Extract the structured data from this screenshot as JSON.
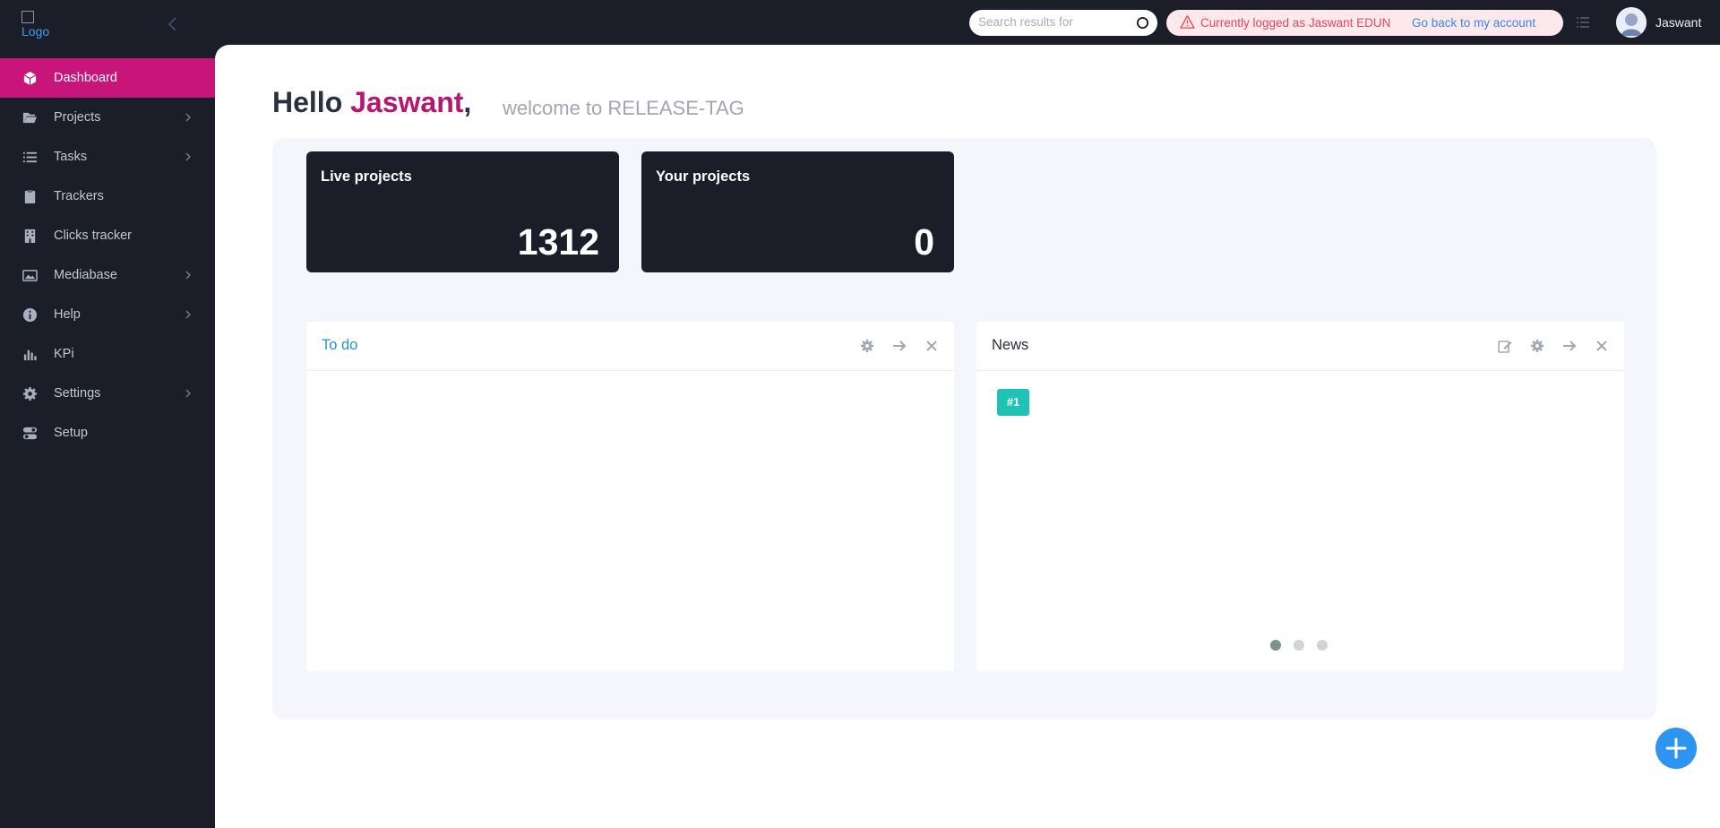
{
  "logo": {
    "alt_text": "Logo"
  },
  "search": {
    "placeholder": "Search results for"
  },
  "impersonation": {
    "message": "Currently logged as Jaswant EDUN",
    "link": "Go back to my account"
  },
  "user": {
    "name": "Jaswant"
  },
  "sidebar": {
    "items": [
      {
        "label": "Dashboard",
        "icon": "cube-icon",
        "active": true,
        "has_submenu": false
      },
      {
        "label": "Projects",
        "icon": "folder-open-icon",
        "active": false,
        "has_submenu": true
      },
      {
        "label": "Tasks",
        "icon": "list-icon",
        "active": false,
        "has_submenu": true
      },
      {
        "label": "Trackers",
        "icon": "clipboard-icon",
        "active": false,
        "has_submenu": false
      },
      {
        "label": "Clicks tracker",
        "icon": "building-icon",
        "active": false,
        "has_submenu": false
      },
      {
        "label": "Mediabase",
        "icon": "image-icon",
        "active": false,
        "has_submenu": true
      },
      {
        "label": "Help",
        "icon": "info-circle-icon",
        "active": false,
        "has_submenu": true
      },
      {
        "label": "KPi",
        "icon": "bar-chart-icon",
        "active": false,
        "has_submenu": false
      },
      {
        "label": "Settings",
        "icon": "gear-icon",
        "active": false,
        "has_submenu": true
      },
      {
        "label": "Setup",
        "icon": "toggle-icon",
        "active": false,
        "has_submenu": false
      }
    ]
  },
  "greeting": {
    "hello": "Hello ",
    "name": "Jaswant",
    "comma": ",",
    "welcome": "welcome to RELEASE-TAG"
  },
  "stats": [
    {
      "title": "Live projects",
      "value": "1312"
    },
    {
      "title": "Your projects",
      "value": "0"
    }
  ],
  "todo_widget": {
    "title": "To do"
  },
  "news_widget": {
    "title": "News",
    "tag": "#1",
    "slides": 3,
    "active_slide": 1
  },
  "colors": {
    "sidebar_bg": "#1b1e28",
    "accent_pink": "#c7157a",
    "link_blue": "#3b86e8",
    "fab_blue": "#2d95ef",
    "news_tag_teal": "#1fc3b6"
  }
}
